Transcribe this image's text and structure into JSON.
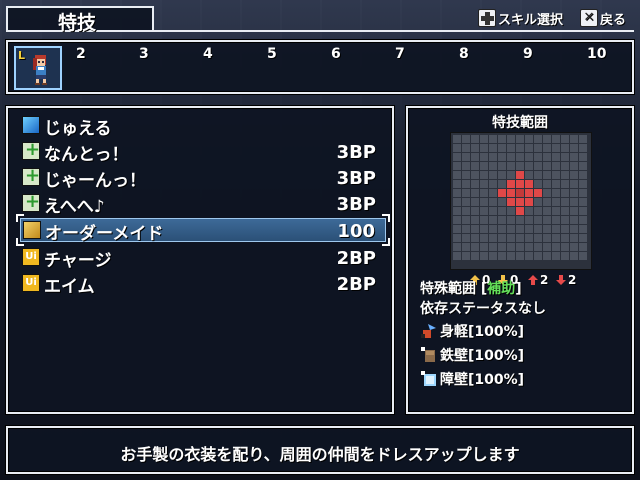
{
  "header": {
    "title": "特技",
    "hint_select": "スキル選択",
    "hint_back": "戻る"
  },
  "party": {
    "active_badge": "L",
    "slots": [
      "2",
      "3",
      "4",
      "5",
      "6",
      "7",
      "8",
      "9",
      "10"
    ]
  },
  "skills": [
    {
      "icon": "jewel-icon",
      "name": "じゅえる",
      "cost": ""
    },
    {
      "icon": "support-plus-icon",
      "name": "なんとっ！",
      "cost": "3BP"
    },
    {
      "icon": "support-plus-icon",
      "name": "じゃーんっ！",
      "cost": "3BP"
    },
    {
      "icon": "support-plus-icon",
      "name": "えへへ♪",
      "cost": "3BP"
    },
    {
      "icon": "costume-icon",
      "name": "オーダーメイド",
      "cost": "100"
    },
    {
      "icon": "utility-icon",
      "name": "チャージ",
      "cost": "2BP"
    },
    {
      "icon": "utility-icon",
      "name": "エイム",
      "cost": "2BP"
    }
  ],
  "range_panel": {
    "title": "特技範囲",
    "stats": [
      "0",
      "0",
      "2",
      "2"
    ],
    "special_label": "特殊範囲 [",
    "special_value": "補助",
    "special_close": "]",
    "dependency": "依存ステータスなし",
    "effects": [
      {
        "icon": "agility-icon",
        "label": "身軽[100%]"
      },
      {
        "icon": "iron-wall-icon",
        "label": "鉄壁[100%]"
      },
      {
        "icon": "barrier-icon",
        "label": "障壁[100%]"
      }
    ]
  },
  "description": "お手製の衣装を配り、周囲の仲間をドレスアップします",
  "colors": {
    "highlight": "#64e05a",
    "range_cell": "#e04848",
    "panel_border": "#e9edf3"
  }
}
